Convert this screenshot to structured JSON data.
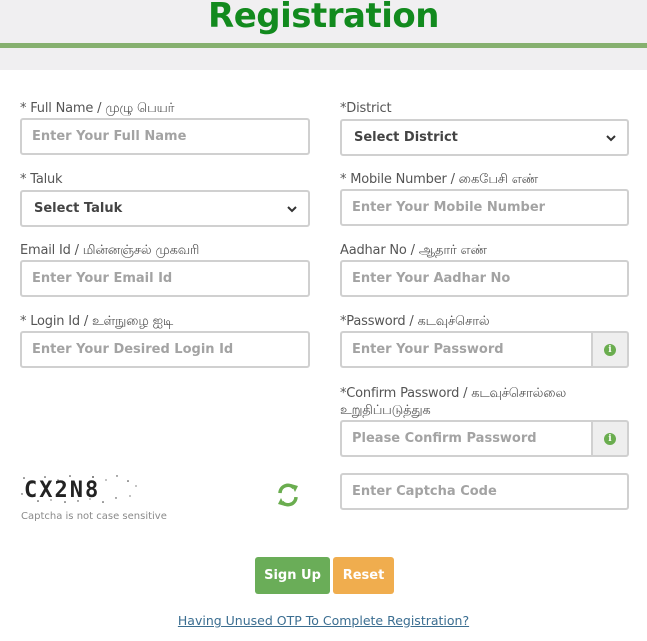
{
  "page": {
    "title": "Registration"
  },
  "form": {
    "full_name": {
      "label": "* Full Name / முழு பெயர்",
      "placeholder": "Enter Your Full Name"
    },
    "district": {
      "label": "*District",
      "selected": "Select District"
    },
    "taluk": {
      "label": "* Taluk",
      "selected": "Select Taluk"
    },
    "mobile": {
      "label": "* Mobile Number / கைபேசி எண்",
      "placeholder": "Enter Your Mobile Number"
    },
    "email": {
      "label": "Email Id / மின்னஞ்சல் முகவரி",
      "placeholder": "Enter Your Email Id"
    },
    "aadhar": {
      "label": "Aadhar No / ஆதார் எண்",
      "placeholder": "Enter Your Aadhar No"
    },
    "login_id": {
      "label": "* Login Id / உள்நுழை ஐடி",
      "placeholder": "Enter Your Desired Login Id"
    },
    "password": {
      "label": "*Password / கடவுச்சொல்",
      "placeholder": "Enter Your Password",
      "addon_icon": "info-circle-icon"
    },
    "confirm_password": {
      "label": "*Confirm Password / கடவுச்சொல்லை உறுதிப்படுத்துக",
      "placeholder": "Please Confirm Password",
      "addon_icon": "info-circle-icon"
    },
    "captcha": {
      "image_text": "CX2N8",
      "note": "Captcha is not case sensitive",
      "refresh_icon": "refresh-icon",
      "placeholder": "Enter Captcha Code"
    }
  },
  "actions": {
    "signup_label": "Sign Up",
    "reset_label": "Reset",
    "otp_link": "Having Unused OTP To Complete Registration?"
  },
  "colors": {
    "title_green": "#128a1e",
    "rule_green": "#86b06f",
    "signup_green": "#6aad58",
    "reset_orange": "#f0ad4e",
    "link_blue": "#3b6e91"
  }
}
